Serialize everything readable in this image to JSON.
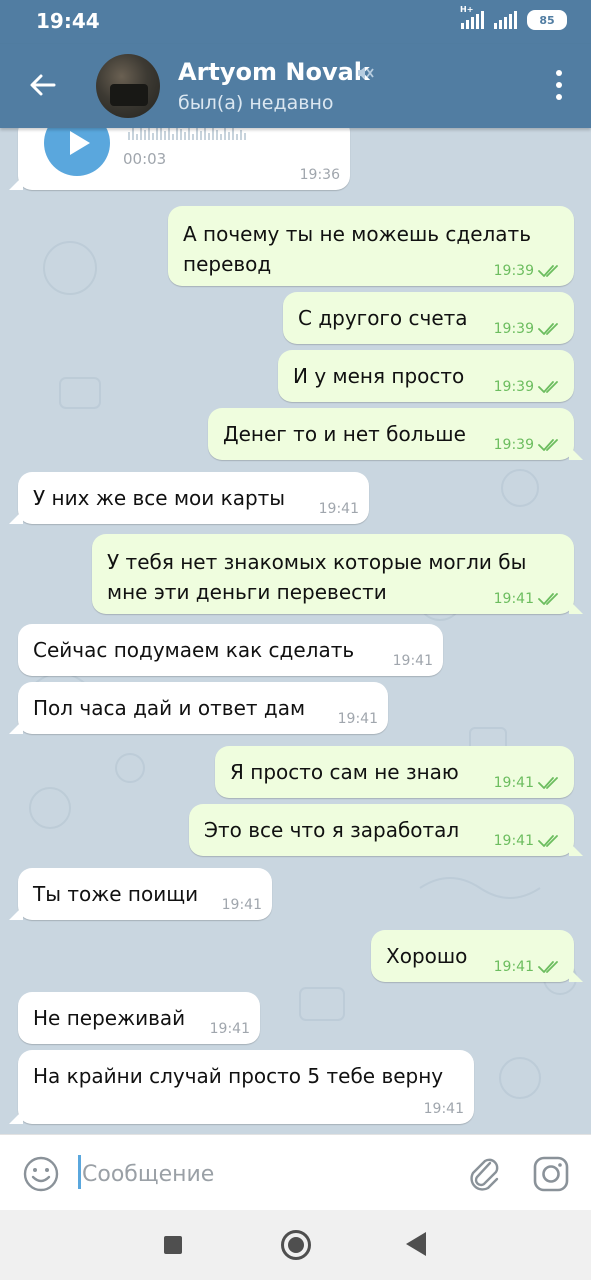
{
  "status_bar": {
    "time": "19:44",
    "network": "H+",
    "battery": "85"
  },
  "header": {
    "contact_name": "Artyom Novak",
    "contact_status": "был(а) недавно"
  },
  "voice_message": {
    "duration": "00:03",
    "time": "19:36"
  },
  "messages": [
    {
      "dir": "out",
      "text": "А почему ты не можешь сделать\nперевод",
      "time": "19:39"
    },
    {
      "dir": "out",
      "text": "С другого счета",
      "time": "19:39"
    },
    {
      "dir": "out",
      "text": "И у меня просто",
      "time": "19:39"
    },
    {
      "dir": "out",
      "text": "Денег то и нет больше",
      "time": "19:39"
    },
    {
      "dir": "in",
      "text": "У них же все мои карты",
      "time": "19:41"
    },
    {
      "dir": "out",
      "text": "У тебя нет знакомых которые могли бы\nмне эти деньги перевести",
      "time": "19:41"
    },
    {
      "dir": "in",
      "text": "Сейчас подумаем как сделать",
      "time": "19:41"
    },
    {
      "dir": "in",
      "text": "Пол часа дай и ответ дам",
      "time": "19:41"
    },
    {
      "dir": "out",
      "text": "Я просто сам не знаю",
      "time": "19:41"
    },
    {
      "dir": "out",
      "text": "Это все что я заработал",
      "time": "19:41"
    },
    {
      "dir": "in",
      "text": "Ты тоже поищи",
      "time": "19:41"
    },
    {
      "dir": "out",
      "text": "Хорошо",
      "time": "19:41"
    },
    {
      "dir": "in",
      "text": "Не переживай",
      "time": "19:41"
    },
    {
      "dir": "in",
      "text": "На крайни случай просто 5 тебе верну",
      "time": "19:41"
    }
  ],
  "input": {
    "placeholder": "Сообщение"
  },
  "icons": {
    "back": "arrow-left-icon",
    "mute": "muted-speaker-icon",
    "menu": "more-vertical-icon",
    "emoji": "smile-icon",
    "attach": "paperclip-icon",
    "camera": "instagram-camera-icon",
    "read": "double-check-icon"
  },
  "colors": {
    "header": "#517da2",
    "outgoing": "#effdde",
    "incoming": "#ffffff",
    "check": "#6cbd5f",
    "play": "#5aa7dd"
  }
}
